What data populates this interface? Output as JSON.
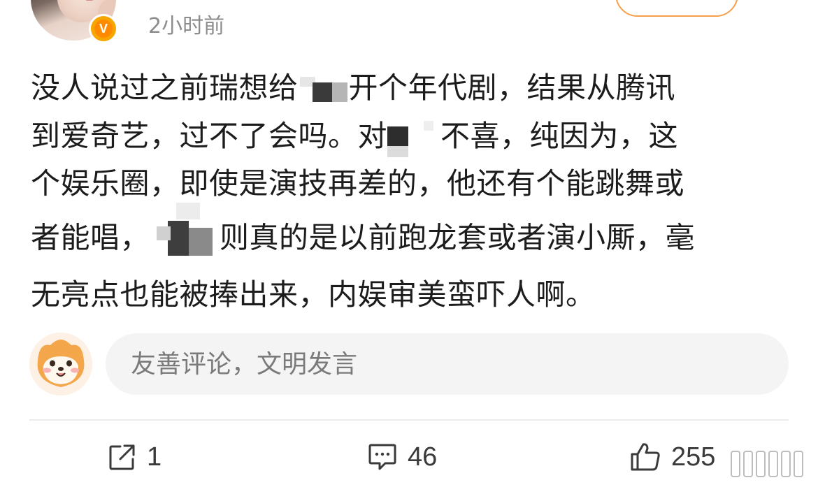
{
  "header": {
    "timestamp": "2小时前",
    "verified_badge": "V"
  },
  "post": {
    "lines": [
      [
        "没人说过之前瑞想给",
        "开个年代剧，结果从腾讯"
      ],
      [
        "到爱奇艺，过不了会吗。对",
        "不喜，纯因为，这"
      ],
      [
        "个娱乐圈，即使是演技再差的，他还有个能跳舞或"
      ],
      [
        "者能唱，",
        "则真的是以前跑龙套或者演小厮，毫"
      ],
      [
        "无亮点也能被捧出来，内娱审美蛮吓人啊。"
      ]
    ]
  },
  "comment_box": {
    "placeholder": "友善评论，文明发言"
  },
  "actions": {
    "share_count": "1",
    "comment_count": "46",
    "like_count": "255"
  },
  "colors": {
    "accent_orange": "#f7a600",
    "follow_border": "#f7a04b",
    "muted_text": "#8c8c8c",
    "input_bg": "#f4f4f4"
  },
  "icons": {
    "share": "share-icon",
    "comment": "comment-icon",
    "like": "thumbs-up-icon"
  }
}
